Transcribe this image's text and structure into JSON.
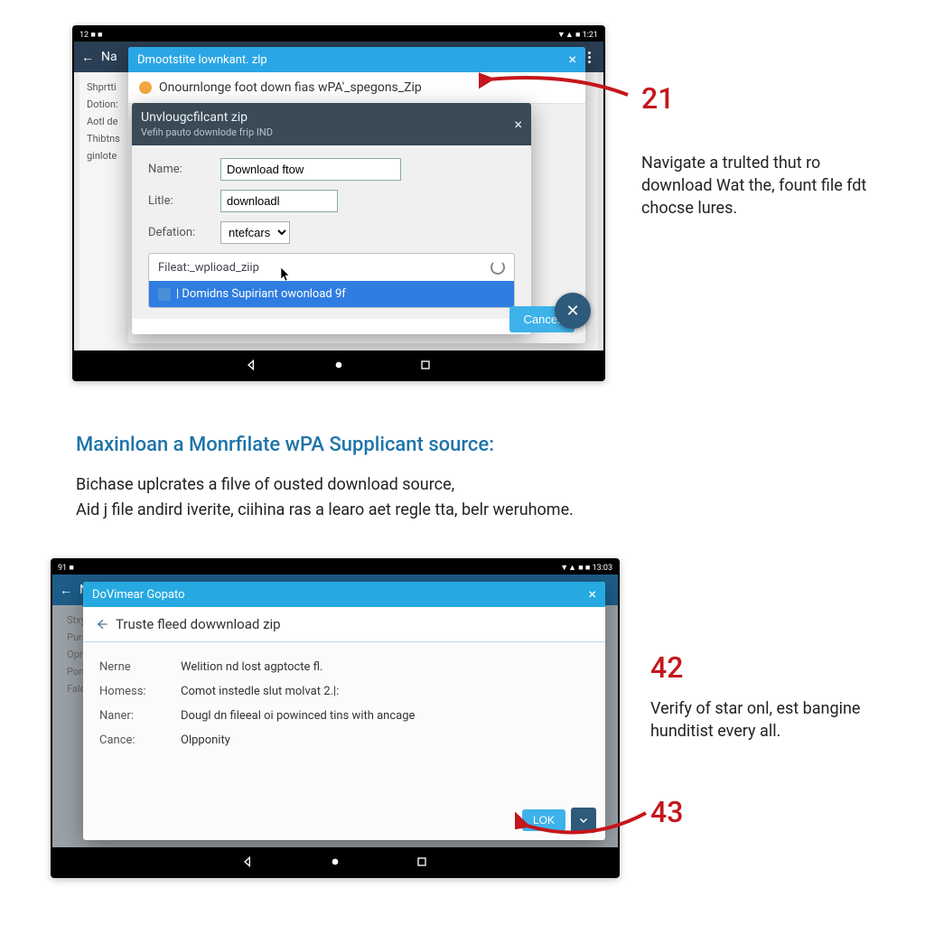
{
  "screenshot1": {
    "statusbar": {
      "left": "12  ■  ■",
      "right": "▼▲ ■ 1:21"
    },
    "appbar": {
      "back": "←",
      "title": "Na"
    },
    "bg_items": [
      "Shprtti",
      "Dotion:",
      "Aotl de",
      "Thibtns",
      "ginlote"
    ],
    "outer_dialog": {
      "title": "Dmootstite lownkant. zlp",
      "notice": "Onournlonge foot down fias wPA'_spegons_Zip"
    },
    "inner_dialog": {
      "title": "Unvlougcfilcant zip",
      "subtitle": "Vefih pauto downlode frip IND",
      "form": {
        "name_label": "Name:",
        "name_value": "Download ftow",
        "title_label": "Litle:",
        "title_value": "downloadl",
        "def_label": "Defation:",
        "def_value": "ntefcars"
      },
      "filelist": {
        "item1": "Fileat:_wplioad_ziip",
        "item2": "| Domidns Supiriant owonload 9f"
      },
      "cancel": "Cancel"
    },
    "fab": "✕"
  },
  "annotation1": {
    "num": "21",
    "text": "Navigate a trulted thut ro download Wat the, fount file fdt chocse lures."
  },
  "middle": {
    "heading": "Maxinloan a Monrfilate wPA Supplicant source:",
    "para": "Bichase uplcrates a filve of ousted download source,\nAid j file andird iverite, ciihina ras a learo aet regle tta, belr weruhome."
  },
  "screenshot2": {
    "statusbar": {
      "left": "91 ■",
      "right": "▼▲ ■ ■ 13:03"
    },
    "appbar": {
      "back": "←",
      "title": "N"
    },
    "bg_items": [
      "Stxy",
      "Purs",
      "Oprei",
      "Ponts",
      "Fale"
    ],
    "dialog": {
      "title": "DoVimear Gopato",
      "header": "Truste fleed dowwnload zip",
      "rows": [
        {
          "k": "Nerne",
          "v": "Welition nd lost agptocte fl."
        },
        {
          "k": "Homess:",
          "v": "Comot instedle slut molvat 2.|:"
        },
        {
          "k": "Naner:",
          "v": "Dougl dn fileeal oi powinced tins with ancage"
        },
        {
          "k": "Cance:",
          "v": "Olpponity"
        }
      ],
      "ok": "LOK"
    }
  },
  "annotation2": {
    "num": "42",
    "text": "Verify of star onl, est bangine hunditist every all."
  },
  "annotation3": {
    "num": "43"
  }
}
